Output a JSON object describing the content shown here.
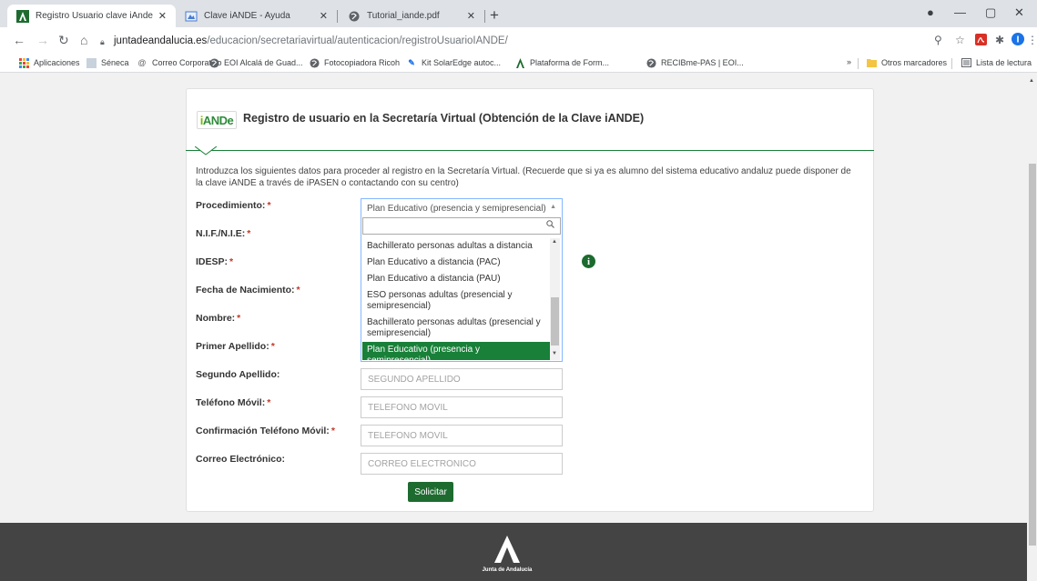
{
  "browser": {
    "tabs": [
      {
        "title": "Registro Usuario clave iAnde",
        "icon": "junta-a-icon",
        "active": true
      },
      {
        "title": "Clave iANDE - Ayuda",
        "icon": "help-favicon",
        "active": false
      },
      {
        "title": "Tutorial_iande.pdf",
        "icon": "globe-icon",
        "active": false
      }
    ],
    "url": {
      "host": "juntadeandalucia.es",
      "path": "/educacion/secretariavirtual/autenticacion/registroUsuarioIANDE/"
    },
    "bookmarks": [
      {
        "label": "Aplicaciones",
        "icon": "apps-grid-icon"
      },
      {
        "label": "Séneca",
        "icon": "seneca-icon"
      },
      {
        "label": "Correo Corporativo",
        "icon": "mail-at-icon"
      },
      {
        "label": "EOI Alcalá de Guad...",
        "icon": "globe-icon"
      },
      {
        "label": "Fotocopiadora Ricoh",
        "icon": "globe-icon"
      },
      {
        "label": "Kit SolarEdge autoc...",
        "icon": "solaredge-icon"
      },
      {
        "label": "Plataforma de Form...",
        "icon": "junta-a-icon"
      },
      {
        "label": "RECIBme-PAS | EOI...",
        "icon": "globe-icon"
      }
    ],
    "other_bookmarks": "Otros marcadores",
    "reading_list": "Lista de lectura",
    "overflow": "»"
  },
  "page": {
    "logo": {
      "i": "i",
      "rest": "ANDe"
    },
    "title": "Registro de usuario en la Secretaría Virtual (Obtención de la Clave iANDE)",
    "intro": "Introduzca los siguientes datos para proceder al registro en la Secretaría Virtual. (Recuerde que si ya es alumno del sistema educativo andaluz puede disponer de la clave iANDE a través de iPASEN o contactando con su centro)",
    "required_mark": "*",
    "fields": {
      "procedimiento": "Procedimiento:",
      "nif": "N.I.F./N.I.E:",
      "idesp": "IDESP:",
      "fecha": "Fecha de Nacimiento:",
      "nombre": "Nombre:",
      "primer_apellido": "Primer Apellido:",
      "segundo_apellido": "Segundo Apellido:",
      "telefono": "Teléfono Móvil:",
      "confirmacion": "Confirmación Teléfono Móvil:",
      "correo": "Correo Electrónico:"
    },
    "placeholders": {
      "segundo_apellido": "SEGUNDO APELLIDO",
      "telefono": "TELÉFONO MÓVIL",
      "confirmacion": "TELÉFONO MÓVIL",
      "correo": "CORREO ELECTRÓNICO"
    },
    "procedimiento_select": {
      "selected": "Plan Educativo (presencia y semipresencial)",
      "search_value": "",
      "options": [
        "Bachillerato personas adultas a distancia",
        "Plan Educativo a distancia (PAC)",
        "Plan Educativo a distancia (PAU)",
        "ESO personas adultas (presencial y semipresencial)",
        "Bachillerato personas adultas (presencial y semipresencial)",
        "Plan Educativo (presencia y semipresencial)"
      ]
    },
    "submit_label": "Solicitar",
    "footer_text": "Junta de Andalucía"
  },
  "colors": {
    "accent_green": "#188038",
    "button_green": "#1e6b30",
    "footer_bg": "#444444",
    "required_red": "#c0392b"
  }
}
